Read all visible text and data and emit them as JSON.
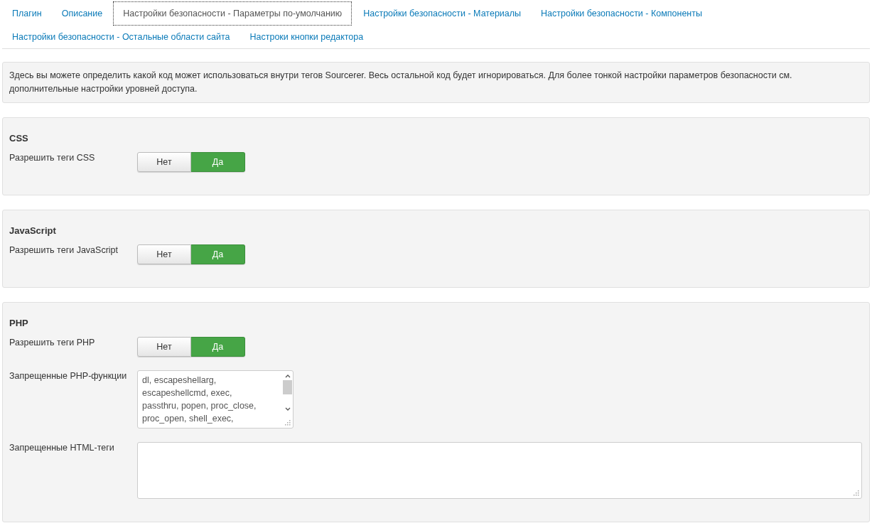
{
  "tabs": [
    {
      "label": "Плагин",
      "selected": false
    },
    {
      "label": "Описание",
      "selected": false
    },
    {
      "label": "Настройки безопасности - Параметры по-умолчанию",
      "selected": true
    },
    {
      "label": "Настройки безопасности - Материалы",
      "selected": false
    },
    {
      "label": "Настройки безопасности - Компоненты",
      "selected": false
    },
    {
      "label": "Настройки безопасности - Остальные области сайта",
      "selected": false
    },
    {
      "label": "Настроки кнопки редактора",
      "selected": false
    }
  ],
  "info": "Здесь вы можете определить какой код может использоваться внутри тегов Sourcerer. Весь остальной код будет игнорироваться. Для более тонкой настройки параметров безопасности см. дополнительные настройки уровней доступа.",
  "sections": [
    {
      "title": "CSS",
      "fields": [
        {
          "kind": "toggle",
          "label": "Разрешить теги CSS",
          "options": [
            {
              "label": "Нет",
              "selected": false
            },
            {
              "label": "Да",
              "selected": true
            }
          ]
        }
      ]
    },
    {
      "title": "JavaScript",
      "fields": [
        {
          "kind": "toggle",
          "label": "Разрешить теги JavaScript",
          "options": [
            {
              "label": "Нет",
              "selected": false
            },
            {
              "label": "Да",
              "selected": true
            }
          ]
        }
      ]
    },
    {
      "title": "PHP",
      "fields": [
        {
          "kind": "toggle",
          "label": "Разрешить теги PHP",
          "options": [
            {
              "label": "Нет",
              "selected": false
            },
            {
              "label": "Да",
              "selected": true
            }
          ]
        },
        {
          "kind": "listbox",
          "label": "Запрещенные PHP-функции",
          "lines": [
            "dl, escapeshellarg,",
            "escapeshellcmd, exec,",
            "passthru, popen, proc_close,",
            "proc_open, shell_exec,"
          ]
        },
        {
          "kind": "textarea",
          "label": "Запрещенные HTML-теги"
        }
      ]
    }
  ]
}
